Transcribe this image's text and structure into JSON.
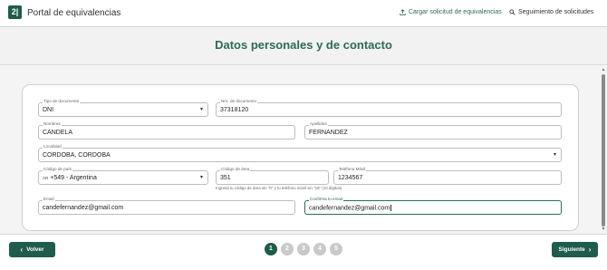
{
  "header": {
    "logo_text": "2|",
    "app_title": "Portal de equivalencias",
    "nav": {
      "upload_label": "Cargar solicitud de equivalencias",
      "tracking_label": "Seguimiento de solicitudes"
    }
  },
  "page_title": "Datos personales y de contacto",
  "form": {
    "doc_type": {
      "label": "Tipo de documento",
      "value": "DNI"
    },
    "doc_number": {
      "label": "Nro. de documento",
      "value": "37318120"
    },
    "first_name": {
      "label": "Nombres",
      "value": "CANDELA"
    },
    "last_name": {
      "label": "Apellidos",
      "value": "FERNANDEZ"
    },
    "locality": {
      "label": "Localidad",
      "value": "CORDOBA, CORDOBA"
    },
    "country_code": {
      "label": "Código de país",
      "flag": "AR",
      "value": "+549 - Argentina"
    },
    "area_code": {
      "label": "Código de área",
      "value": "351"
    },
    "mobile": {
      "label": "Teléfono Móvil",
      "value": "1234567"
    },
    "phone_hint": "Ingresá tu código de área sin \"0\" y tu teléfono móvil sin \"15\" (10 dígitos)",
    "email": {
      "label": "Email",
      "value": "candefernandez@gmail.com"
    },
    "email_confirm": {
      "label": "Confirma tu email",
      "value": "candefernandez@gmail.com"
    }
  },
  "footer": {
    "back_label": "Volver",
    "next_label": "Siguiente",
    "steps": [
      "1",
      "2",
      "3",
      "4",
      "5"
    ],
    "current_step": 1
  },
  "colors": {
    "primary": "#1f5c4b",
    "accent_text": "#2d6a58",
    "step_inactive": "#c9c9c9"
  }
}
